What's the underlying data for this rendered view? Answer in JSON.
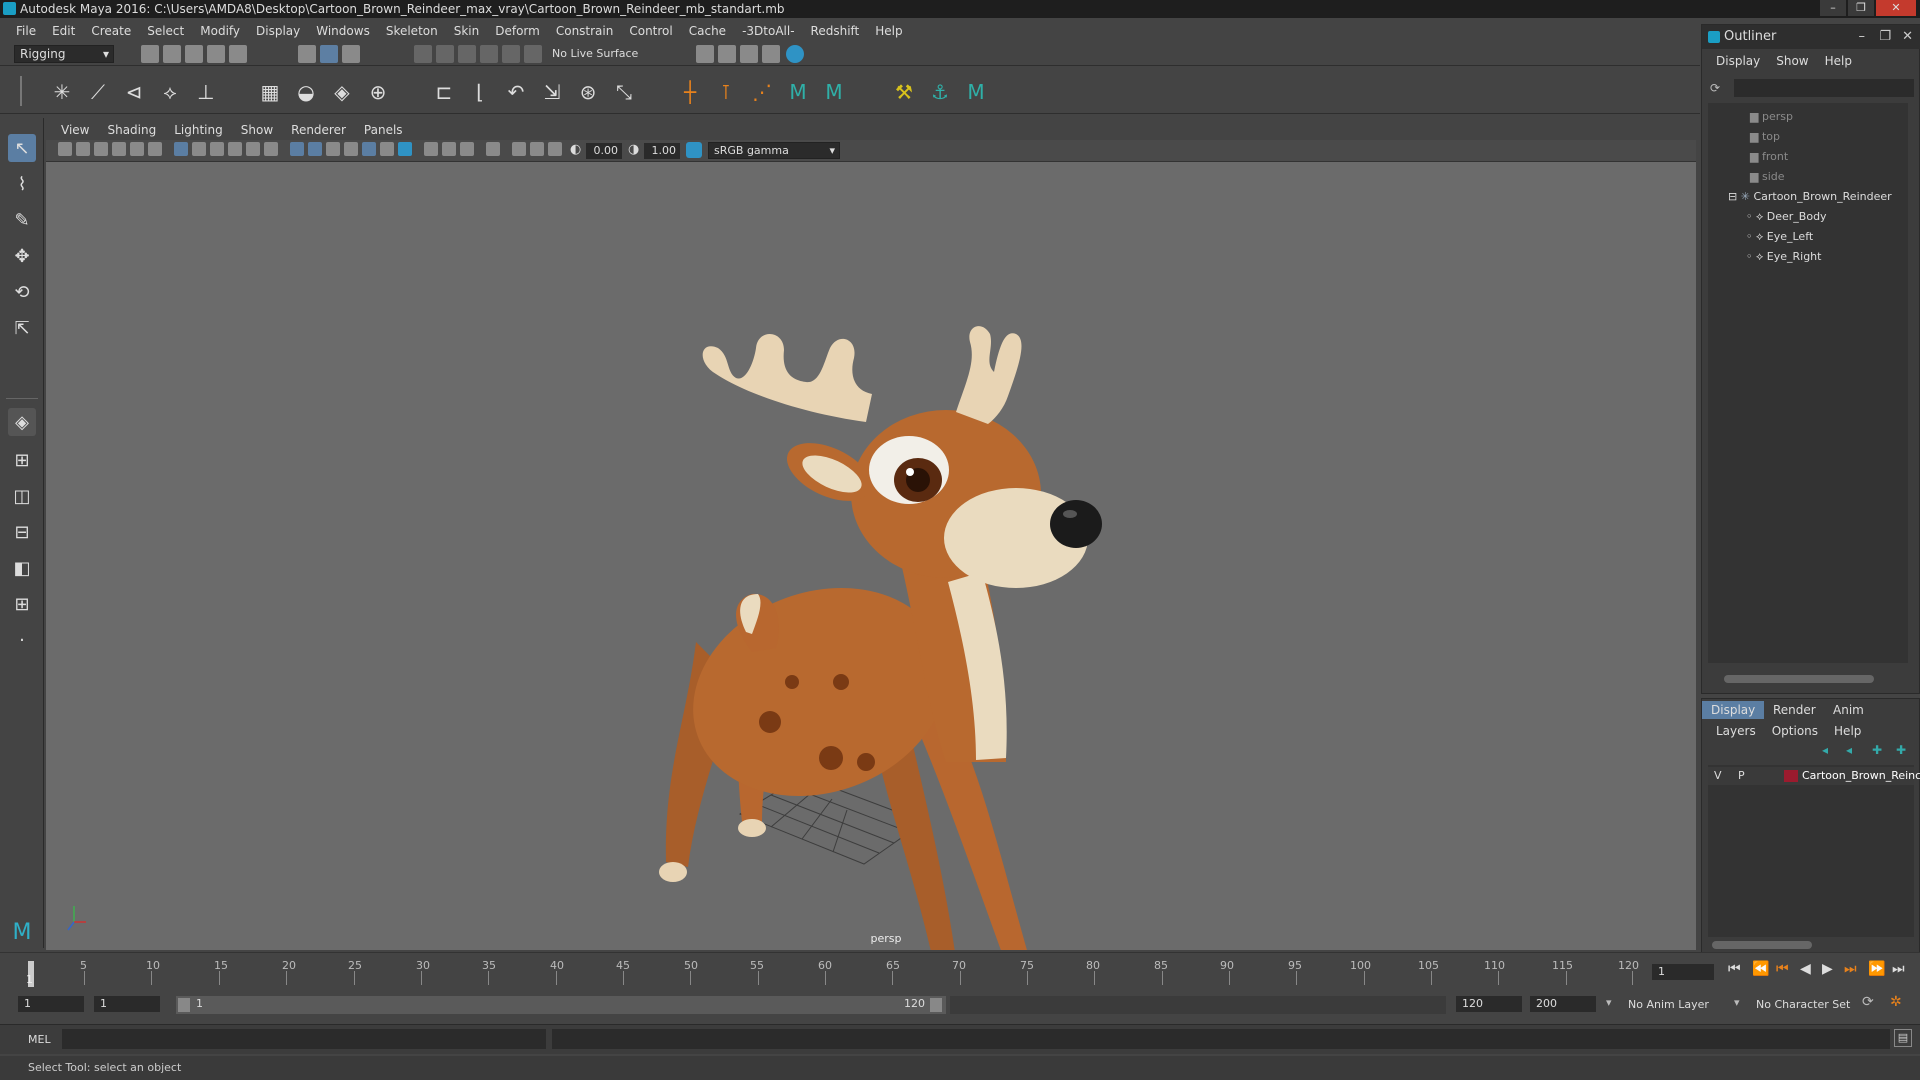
{
  "window": {
    "title": "Autodesk Maya 2016: C:\\Users\\AMDA8\\Desktop\\Cartoon_Brown_Reindeer_max_vray\\Cartoon_Brown_Reindeer_mb_standart.mb"
  },
  "menubar": [
    "File",
    "Edit",
    "Create",
    "Select",
    "Modify",
    "Display",
    "Windows",
    "Skeleton",
    "Skin",
    "Deform",
    "Constrain",
    "Control",
    "Cache",
    "-3DtoAll-",
    "Redshift",
    "Help"
  ],
  "statusline": {
    "mode": "Rigging",
    "live_surface": "No Live Surface"
  },
  "panel": {
    "menus": [
      "View",
      "Shading",
      "Lighting",
      "Show",
      "Renderer",
      "Panels"
    ],
    "exposure": "0.00",
    "gamma": "1.00",
    "colorspace": "sRGB gamma",
    "camera_label": "persp"
  },
  "outliner": {
    "title": "Outliner",
    "menus": [
      "Display",
      "Show",
      "Help"
    ],
    "cameras": [
      "persp",
      "top",
      "front",
      "side"
    ],
    "group": "Cartoon_Brown_Reindeer",
    "children": [
      "Deer_Body",
      "Eye_Left",
      "Eye_Right"
    ]
  },
  "layers": {
    "tabs": [
      "Display",
      "Render",
      "Anim"
    ],
    "menus": [
      "Layers",
      "Options",
      "Help"
    ],
    "row": {
      "v": "V",
      "p": "P",
      "name": "Cartoon_Brown_Reinc",
      "color": "#9b1b2e"
    }
  },
  "timeline": {
    "ticks": [
      "5",
      "10",
      "15",
      "20",
      "25",
      "30",
      "35",
      "40",
      "45",
      "50",
      "55",
      "60",
      "65",
      "70",
      "75",
      "80",
      "85",
      "90",
      "95",
      "100",
      "105",
      "110",
      "115",
      "120"
    ],
    "start_marker": "1",
    "current_frame": "1"
  },
  "range": {
    "start": "1",
    "playback_start": "1",
    "slider_start": "1",
    "slider_end": "120",
    "playback_end": "120",
    "end": "200",
    "anim_layer": "No Anim Layer",
    "character_set": "No Character Set"
  },
  "cmdline": {
    "label": "MEL"
  },
  "helpline": {
    "text": "Select Tool: select an object"
  }
}
